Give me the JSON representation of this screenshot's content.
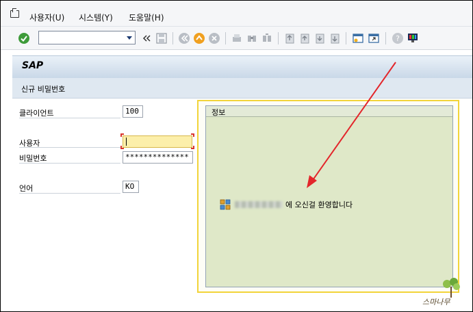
{
  "menu": {
    "items": [
      "사용자(U)",
      "시스템(Y)",
      "도움말(H)"
    ]
  },
  "toolbar": {
    "command_field_value": "",
    "icons": [
      "check-icon",
      "dropdown-icon",
      "double-left-icon",
      "save-icon",
      "back-icon",
      "exit-icon",
      "cancel-icon",
      "print-icon",
      "find-icon",
      "find-next-icon",
      "first-page-icon",
      "prev-page-icon",
      "next-page-icon",
      "last-page-icon",
      "new-session-icon",
      "shortcut-icon",
      "help-icon",
      "layout-icon"
    ]
  },
  "title": {
    "app": "SAP",
    "subtitle": "신규 비밀번호"
  },
  "form": {
    "client_label": "클라이언트",
    "client_value": "100",
    "user_label": "사용자",
    "user_value": "",
    "password_label": "비밀번호",
    "password_value": "**************",
    "language_label": "언어",
    "language_value": "KO"
  },
  "info": {
    "heading": "정보",
    "welcome_text": "에 오신걸 환영합니다"
  },
  "colors": {
    "title_bar": "#c9d8e8",
    "info_background": "#dfe8c8",
    "highlight_border": "#f2d43a",
    "annotation_arrow": "#e3262b",
    "user_field": "#fcefaa"
  },
  "watermark": {
    "text": "스마나무"
  }
}
